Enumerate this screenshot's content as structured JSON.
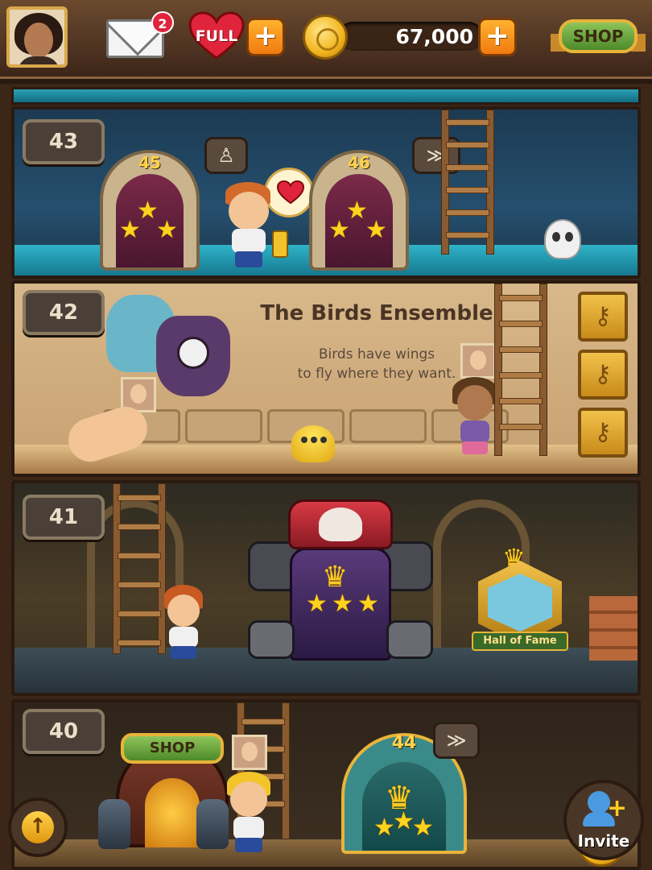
{
  "topbar": {
    "mail_badge": "2",
    "hearts_label": "FULL",
    "plus_symbol": "+",
    "coins": "67,000",
    "shop_label": "SHOP"
  },
  "floors": [
    {
      "number": "43",
      "doors": [
        {
          "number": "45",
          "stars": 3
        },
        {
          "number": "46",
          "stars": 3
        }
      ]
    },
    {
      "number": "42",
      "title": "The Birds Ensemble",
      "description_line1": "Birds have wings",
      "description_line2": "to fly where they want."
    },
    {
      "number": "41",
      "hall_of_fame_label": "Hall of Fame",
      "boss_stars": 3
    },
    {
      "number": "40",
      "shop_label": "SHOP",
      "door": {
        "number": "44",
        "stars": 3
      }
    }
  ],
  "buttons": {
    "up_arrow": "↑",
    "invite_label": "Invite",
    "invite_plus": "+"
  },
  "icons": {
    "key": "⚷",
    "chevron_double": "≫",
    "tile_icon": "♙"
  },
  "colors": {
    "gold": "#ffd21e",
    "heart_red": "#e0243c",
    "shop_green": "#6aa83e",
    "floor_teal": "#2fb3c8"
  }
}
